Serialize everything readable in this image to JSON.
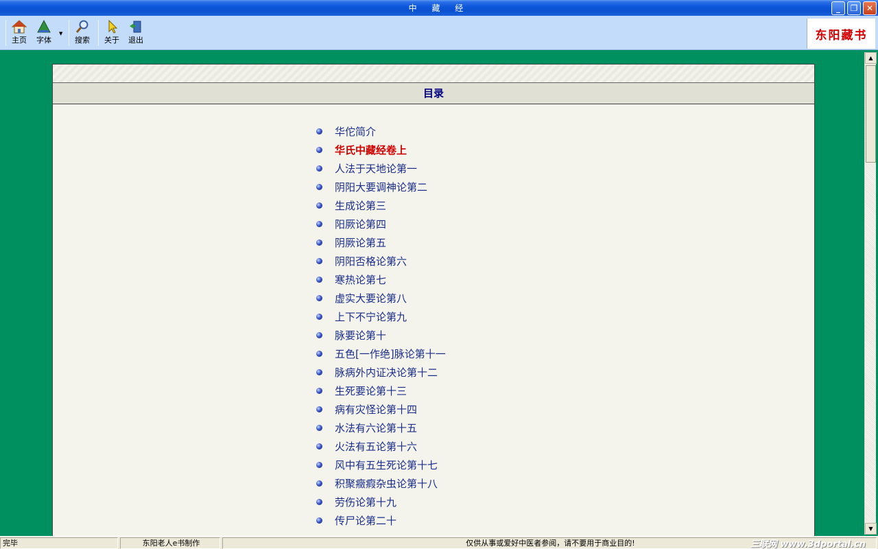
{
  "window": {
    "title": "中 藏 经",
    "controls": {
      "minimize": "_",
      "restore": "❐",
      "close": "✕"
    }
  },
  "toolbar": {
    "buttons": [
      {
        "label": "主页",
        "icon": "home-icon"
      },
      {
        "label": "字体",
        "icon": "font-icon"
      },
      {
        "label": "搜索",
        "icon": "search-icon"
      },
      {
        "label": "关于",
        "icon": "pointer-icon"
      },
      {
        "label": "退出",
        "icon": "exit-icon"
      }
    ],
    "brand": "东阳藏书"
  },
  "page": {
    "header": "目录",
    "toc": [
      {
        "label": "华佗简介",
        "active": false
      },
      {
        "label": "华氏中藏经卷上",
        "active": true
      },
      {
        "label": "人法于天地论第一",
        "active": false
      },
      {
        "label": "阴阳大要调神论第二",
        "active": false
      },
      {
        "label": "生成论第三",
        "active": false
      },
      {
        "label": "阳厥论第四",
        "active": false
      },
      {
        "label": "阴厥论第五",
        "active": false
      },
      {
        "label": "阴阳否格论第六",
        "active": false
      },
      {
        "label": "寒热论第七",
        "active": false
      },
      {
        "label": "虚实大要论第八",
        "active": false
      },
      {
        "label": "上下不宁论第九",
        "active": false
      },
      {
        "label": "脉要论第十",
        "active": false
      },
      {
        "label": "五色[一作绝]脉论第十一",
        "active": false
      },
      {
        "label": "脉病外内证决论第十二",
        "active": false
      },
      {
        "label": "生死要论第十三",
        "active": false
      },
      {
        "label": "病有灾怪论第十四",
        "active": false
      },
      {
        "label": "水法有六论第十五",
        "active": false
      },
      {
        "label": "火法有五论第十六",
        "active": false
      },
      {
        "label": "风中有五生死论第十七",
        "active": false
      },
      {
        "label": "积聚癥瘕杂虫论第十八",
        "active": false
      },
      {
        "label": "劳伤论第十九",
        "active": false
      },
      {
        "label": "传尸论第二十",
        "active": false
      }
    ]
  },
  "statusbar": {
    "status": "完毕",
    "maker": "东阳老人e书制作",
    "notice": "仅供从事或爱好中医者参阅，请不要用于商业目的!",
    "watermark": "三联网 www.3dportal.cn"
  },
  "colors": {
    "background": "#008f5e",
    "link": "#1a2e8a",
    "active_link": "#d00000",
    "brand": "#d40000"
  }
}
